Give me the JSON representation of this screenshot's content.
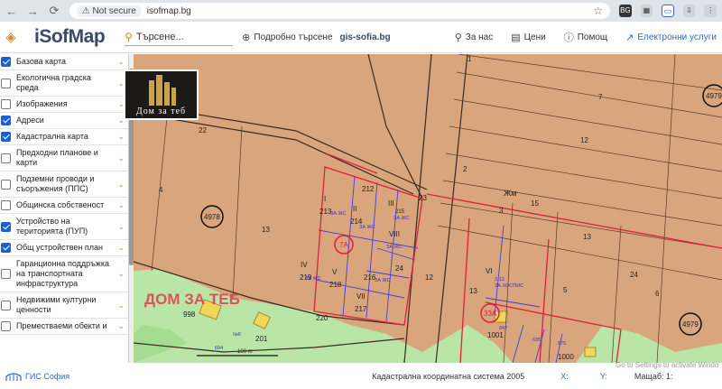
{
  "browser": {
    "security_label": "Not secure",
    "url": "isofmap.bg",
    "profile_badge": "BG"
  },
  "header": {
    "logo": "iSofMap",
    "search_placeholder": "Търсене...",
    "advanced_search": "Подробно търсене",
    "gis_link": "gis-sofia.bg",
    "about": "За нас",
    "prices": "Цени",
    "help": "Помощ",
    "services": "Електронни услуги"
  },
  "sidebar": {
    "layers": [
      {
        "label": "Базова карта",
        "checked": true
      },
      {
        "label": "Екологична градска среда",
        "checked": false
      },
      {
        "label": "Изображения",
        "checked": false
      },
      {
        "label": "Адреси",
        "checked": true
      },
      {
        "label": "Кадастрална карта",
        "checked": true
      },
      {
        "label": "Предходни планове и карти",
        "checked": false
      },
      {
        "label": "Подземни проводи и съоръжения (ППС)",
        "checked": false
      },
      {
        "label": "Общинска собственост",
        "checked": false
      },
      {
        "label": "Устройство на територията (ПУП)",
        "checked": true
      },
      {
        "label": "Общ устройствен план",
        "checked": true
      },
      {
        "label": "Гаранционна поддръжка на транспортната инфраструктура",
        "checked": false
      },
      {
        "label": "Недвижими културни ценности",
        "checked": false
      },
      {
        "label": "Преместваеми обекти и",
        "checked": false
      }
    ]
  },
  "map": {
    "watermark_logo_text": "Дом за теб",
    "watermark_text": "ДОМ ЗА ТЕБ",
    "street_label": "Жм",
    "circle_labels": [
      "4978",
      "4979",
      "4979",
      "7А",
      "33А"
    ],
    "parcels": [
      "1",
      "2",
      "3",
      "4",
      "7",
      "12",
      "12",
      "13",
      "13",
      "13",
      "15",
      "22",
      "23",
      "24",
      "24",
      "5",
      "6",
      "201",
      "212",
      "213",
      "214",
      "215",
      "216",
      "217",
      "218",
      "219",
      "220",
      "998",
      "1000",
      "1001"
    ],
    "romans": [
      "I",
      "II",
      "III",
      "IV",
      "V",
      "VI",
      "VII",
      "VIII"
    ],
    "zone_labels": [
      "ЗА ЖС",
      "ЗА ЖС",
      "ЗА ЖС",
      "ЗА ЖС",
      "ЗА ЖС",
      "ЗА ЖС",
      "ЗА ХОСПИС"
    ],
    "scale_bar": "100 m",
    "misc_small": [
      "№6",
      "2.13",
      "694",
      "847",
      "635",
      "975"
    ]
  },
  "status": {
    "brand": "ГИС София",
    "coord_system": "Кадастрална координатна система 2005",
    "x_label": "X:",
    "y_label": "Y:",
    "scale_label": "Мащаб: 1:",
    "activate_windows": "Go to Settings to activate Windo"
  },
  "colors": {
    "parcel_fill": "#d9a57c",
    "green_zone": "#b9e6a6",
    "purple_lines": "#4b3bd6",
    "red_lines": "#e0203a",
    "accent_orange": "#d48a2e",
    "checkbox_blue": "#1a5fd6"
  }
}
